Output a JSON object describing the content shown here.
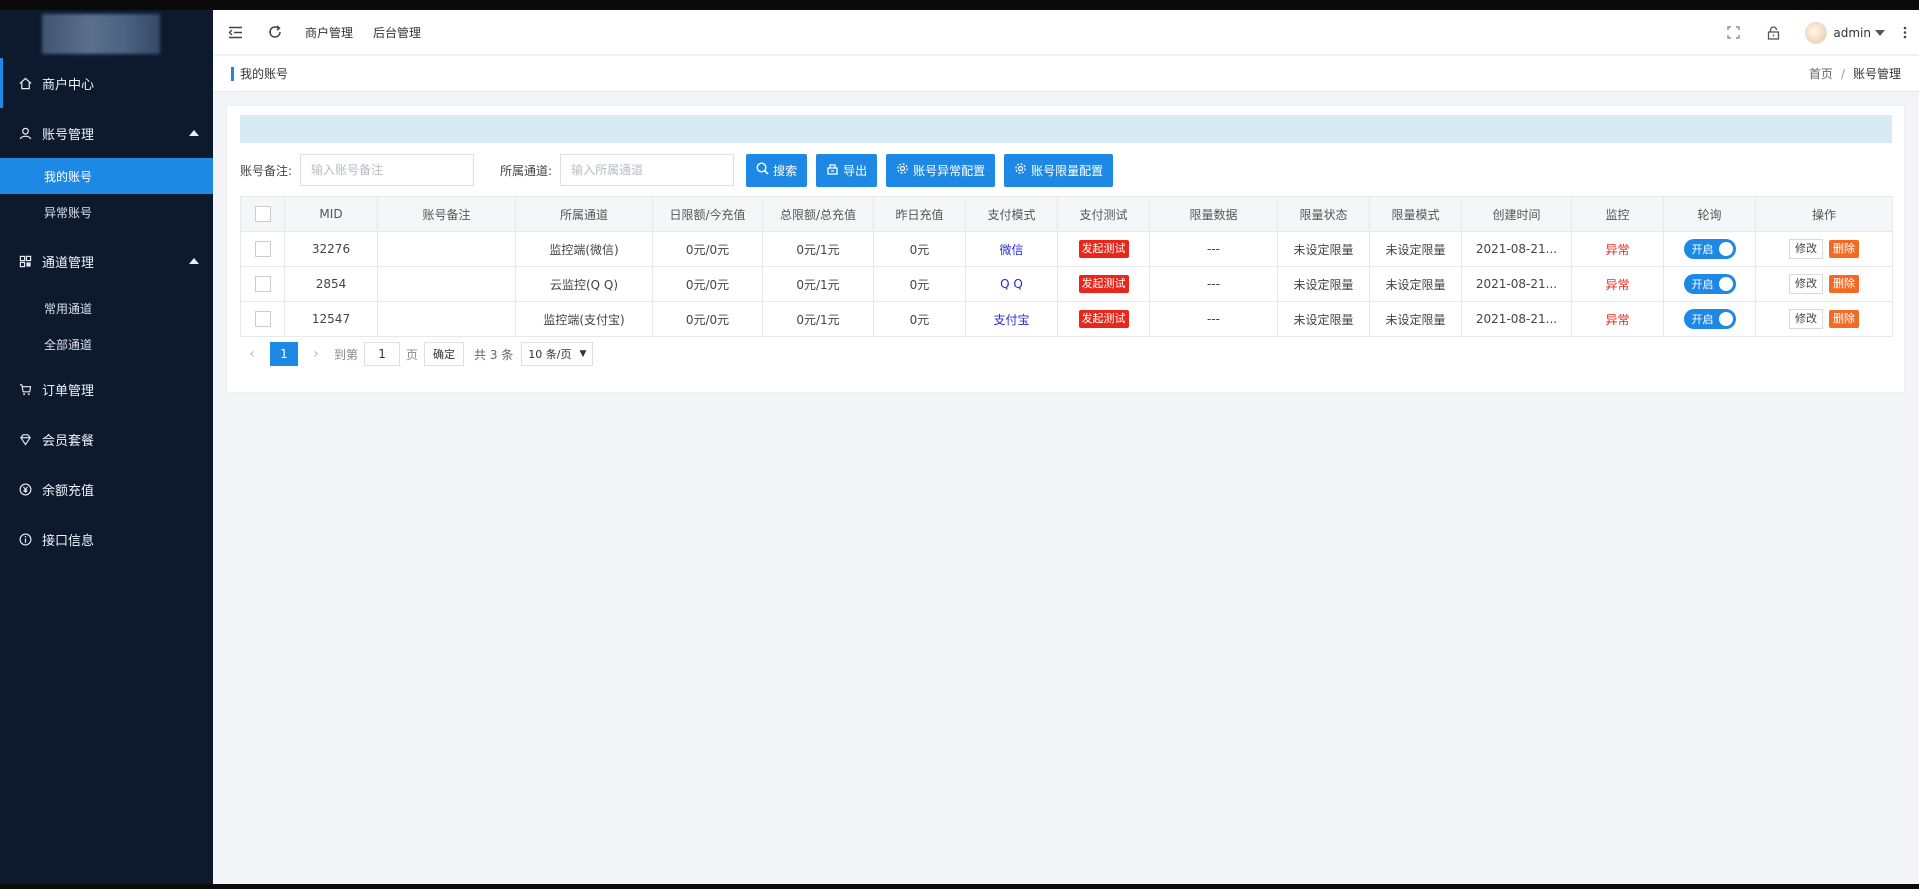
{
  "sidebar": {
    "items": [
      {
        "label": "商户中心",
        "icon": "home-icon"
      },
      {
        "label": "账号管理",
        "icon": "user-icon",
        "children": [
          {
            "label": "我的账号",
            "selected": true
          },
          {
            "label": "异常账号"
          }
        ]
      },
      {
        "label": "通道管理",
        "icon": "channel-icon",
        "children": [
          {
            "label": "常用通道"
          },
          {
            "label": "全部通道"
          }
        ]
      },
      {
        "label": "订单管理",
        "icon": "cart-icon"
      },
      {
        "label": "会员套餐",
        "icon": "diamond-icon"
      },
      {
        "label": "余额充值",
        "icon": "yen-icon"
      },
      {
        "label": "接口信息",
        "icon": "info-icon"
      }
    ]
  },
  "header": {
    "tabs": [
      "商户管理",
      "后台管理"
    ],
    "user": "admin"
  },
  "subheader": {
    "title": "我的账号",
    "breadcrumb": [
      "首页",
      "账号管理"
    ]
  },
  "filters": {
    "note_label": "账号备注:",
    "note_placeholder": "输入账号备注",
    "channel_label": "所属通道:",
    "channel_placeholder": "输入所属通道",
    "search_btn": "搜索",
    "export_btn": "导出",
    "abnormal_cfg_btn": "账号异常配置",
    "limit_cfg_btn": "账号限量配置"
  },
  "table": {
    "headers": [
      "MID",
      "账号备注",
      "所属通道",
      "日限额/今充值",
      "总限额/总充值",
      "昨日充值",
      "支付模式",
      "支付测试",
      "限量数据",
      "限量状态",
      "限量模式",
      "创建时间",
      "监控",
      "轮询",
      "操作"
    ],
    "rows": [
      {
        "mid": "32276",
        "note": "",
        "channel": "监控端(微信)",
        "daily": "0元/0元",
        "total": "0元/1元",
        "yesterday": "0元",
        "mode": "微信",
        "test": "发起测试",
        "limit_data": "---",
        "limit_status": "未设定限量",
        "limit_mode": "未设定限量",
        "created": "2021-08-21...",
        "monitor": "异常",
        "poll": "开启",
        "edit": "修改",
        "del": "删除"
      },
      {
        "mid": "2854",
        "note": "",
        "channel": "云监控(Q Q)",
        "daily": "0元/0元",
        "total": "0元/1元",
        "yesterday": "0元",
        "mode": "Q Q",
        "test": "发起测试",
        "limit_data": "---",
        "limit_status": "未设定限量",
        "limit_mode": "未设定限量",
        "created": "2021-08-21...",
        "monitor": "异常",
        "poll": "开启",
        "edit": "修改",
        "del": "删除"
      },
      {
        "mid": "12547",
        "note": "",
        "channel": "监控端(支付宝)",
        "daily": "0元/0元",
        "total": "0元/1元",
        "yesterday": "0元",
        "mode": "支付宝",
        "test": "发起测试",
        "limit_data": "---",
        "limit_status": "未设定限量",
        "limit_mode": "未设定限量",
        "created": "2021-08-21...",
        "monitor": "异常",
        "poll": "开启",
        "edit": "修改",
        "del": "删除"
      }
    ]
  },
  "pager": {
    "current": "1",
    "goto_label": "到第",
    "goto_value": "1",
    "page_unit": "页",
    "ok": "确定",
    "total": "共 3 条",
    "page_size": "10 条/页"
  },
  "colors": {
    "primary": "#1e88e5",
    "sidebar_bg": "#0d1a2e",
    "danger": "#e8261a",
    "delete": "#f36a25"
  }
}
